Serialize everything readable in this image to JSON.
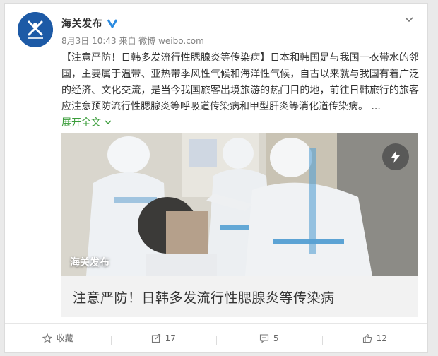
{
  "post": {
    "username": "海关发布",
    "meta": "8月3日 10:43 来自 微博 weibo.com",
    "text": "【注意严防！日韩多发流行性腮腺炎等传染病】日本和韩国是与我国一衣带水的邻国，主要属于温带、亚热带季风性气候和海洋性气候，自古以来就与我国有着广泛的经济、文化交流，是当今我国旅客出境旅游的热门目的地，前往日韩旅行的旅客应注意预防流行性腮腺炎等呼吸道传染病和甲型肝炎等消化道传染病。 ...",
    "expand_label": "展开全文",
    "media_watermark": "海关发布",
    "caption": "注意严防！日韩多发流行性腮腺炎等传染病"
  },
  "footer": {
    "favorite_label": "收藏",
    "repost_count": "17",
    "comment_count": "5",
    "like_count": "12"
  },
  "colors": {
    "link": "#3a9d3a",
    "verified": "#2b8be0",
    "avatar_bg": "#1d5aa6"
  }
}
